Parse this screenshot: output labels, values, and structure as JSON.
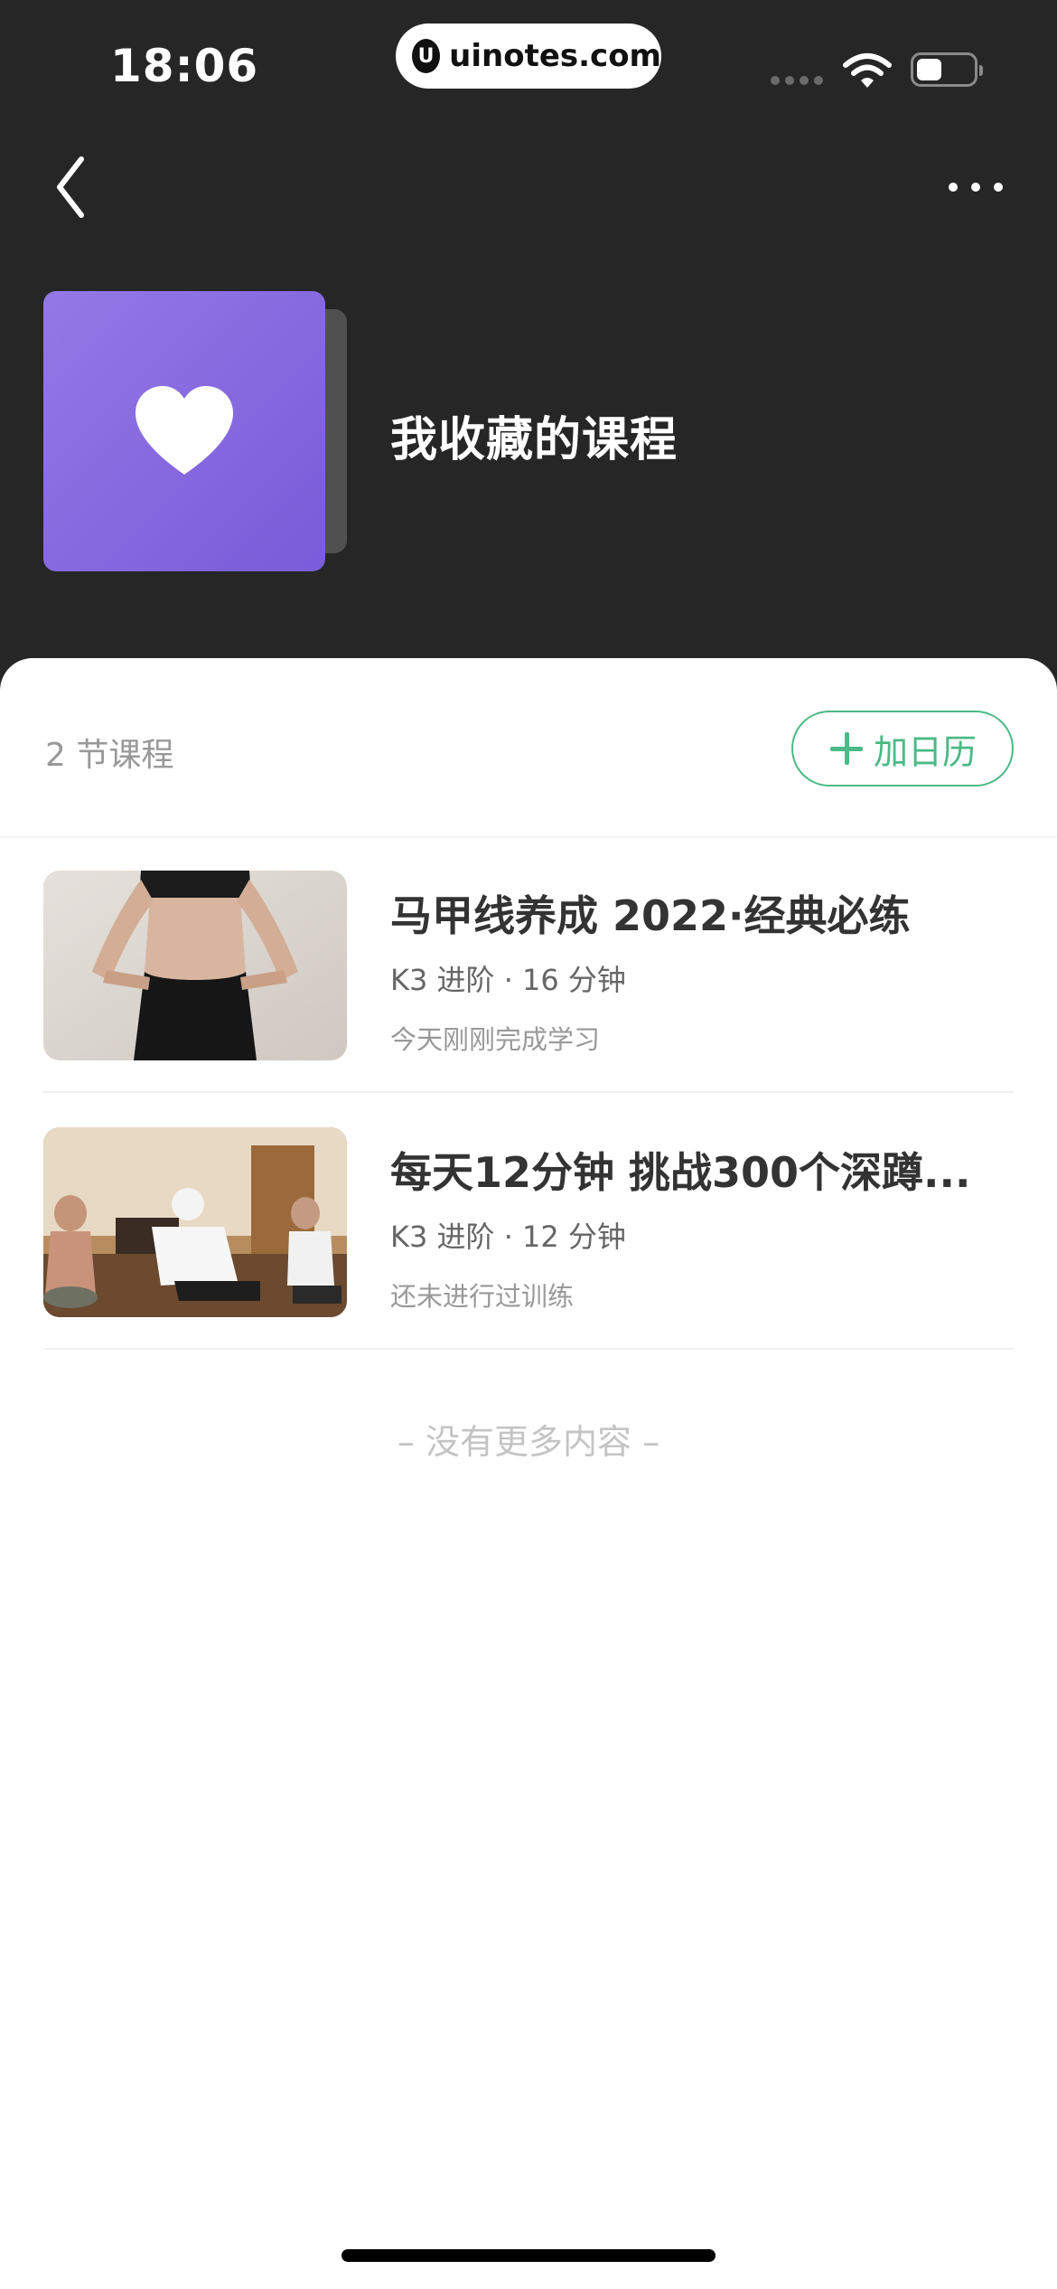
{
  "status_bar": {
    "time": "18:06",
    "url": "uinotes.com",
    "url_logo": "U",
    "icons": [
      "signal-dots-icon",
      "wifi-icon",
      "battery-icon"
    ],
    "battery_level": 0.45
  },
  "header": {
    "back_icon": "chevron-left-icon",
    "more_icon": "more-dots-icon",
    "cover_icon": "heart-icon",
    "title": "我收藏的课程"
  },
  "toolbar": {
    "count": "2 节课程",
    "calendar_button": "加日历",
    "calendar_icon": "plus-icon"
  },
  "courses": [
    {
      "title": "马甲线养成 2022·经典必练",
      "meta": "K3 进阶 · 16 分钟",
      "status": "今天刚刚完成学习"
    },
    {
      "title": "每天12分钟 挑战300个深蹲...",
      "meta": "K3 进阶 · 12 分钟",
      "status": "还未进行过训练"
    }
  ],
  "footer": {
    "no_more": "– 没有更多内容 –"
  },
  "colors": {
    "header_bg": "#262626",
    "accent_green": "#4aba86",
    "cover_purple": "#8466df"
  }
}
